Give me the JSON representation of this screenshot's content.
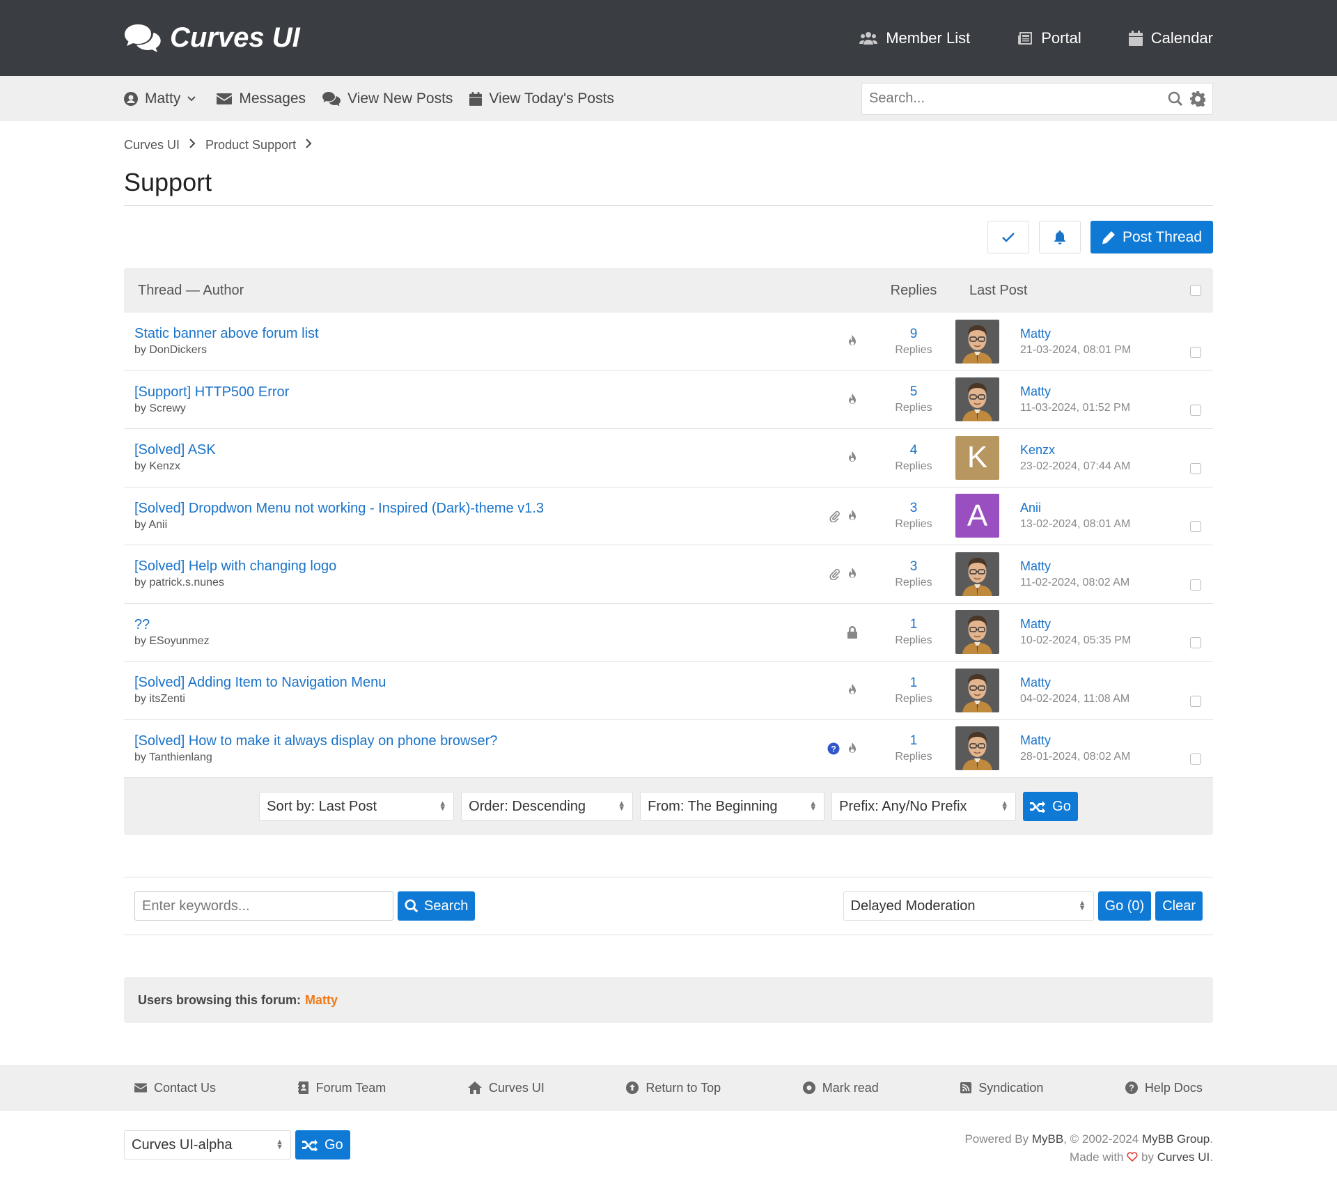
{
  "brand": {
    "name": "Curves UI"
  },
  "topnav": [
    {
      "label": "Member List",
      "icon": "users-icon"
    },
    {
      "label": "Portal",
      "icon": "newspaper-icon"
    },
    {
      "label": "Calendar",
      "icon": "calendar-icon"
    }
  ],
  "subnav": {
    "user": "Matty",
    "messages": "Messages",
    "new_posts": "View New Posts",
    "today_posts": "View Today's Posts",
    "search_placeholder": "Search..."
  },
  "breadcrumb": [
    "Curves UI",
    "Product Support"
  ],
  "page_title": "Support",
  "post_thread": "Post Thread",
  "table": {
    "col_thread": "Thread — Author",
    "col_replies": "Replies",
    "col_last": "Last Post",
    "replies_label": "Replies",
    "threads": [
      {
        "title": "Static banner above forum list",
        "author": "by DonDickers",
        "replies": "9",
        "last_user": "Matty",
        "last_date": "21-03-2024, 08:01 PM",
        "avatar": "photo",
        "icons": [
          "fire"
        ]
      },
      {
        "title": "[Support] HTTP500 Error",
        "author": "by Screwy",
        "replies": "5",
        "last_user": "Matty",
        "last_date": "11-03-2024, 01:52 PM",
        "avatar": "photo",
        "icons": [
          "fire"
        ]
      },
      {
        "title": "[Solved] ASK",
        "author": "by Kenzx",
        "replies": "4",
        "last_user": "Kenzx",
        "last_date": "23-02-2024, 07:44 AM",
        "avatar": "K",
        "icons": [
          "fire"
        ]
      },
      {
        "title": "[Solved] Dropdwon Menu not working - Inspired (Dark)-theme v1.3",
        "author": "by Anii",
        "replies": "3",
        "last_user": "Anii",
        "last_date": "13-02-2024, 08:01 AM",
        "avatar": "A",
        "icons": [
          "paperclip",
          "fire"
        ]
      },
      {
        "title": "[Solved] Help with changing logo",
        "author": "by patrick.s.nunes",
        "replies": "3",
        "last_user": "Matty",
        "last_date": "11-02-2024, 08:02 AM",
        "avatar": "photo",
        "icons": [
          "paperclip",
          "fire"
        ]
      },
      {
        "title": "??",
        "author": "by ESoyunmez",
        "replies": "1",
        "last_user": "Matty",
        "last_date": "10-02-2024, 05:35 PM",
        "avatar": "photo",
        "icons": [
          "lock"
        ]
      },
      {
        "title": "[Solved] Adding Item to Navigation Menu",
        "author": "by itsZenti",
        "replies": "1",
        "last_user": "Matty",
        "last_date": "04-02-2024, 11:08 AM",
        "avatar": "photo",
        "icons": [
          "fire"
        ]
      },
      {
        "title": "[Solved] How to make it always display on phone browser?",
        "author": "by Tanthienlang",
        "replies": "1",
        "last_user": "Matty",
        "last_date": "28-01-2024, 08:02 AM",
        "avatar": "photo",
        "icons": [
          "question",
          "fire"
        ]
      }
    ]
  },
  "sortbar": {
    "sort": "Sort by: Last Post",
    "order": "Order: Descending",
    "from": "From: The Beginning",
    "prefix": "Prefix: Any/No Prefix",
    "go": "Go"
  },
  "lowerbar": {
    "keywords_placeholder": "Enter keywords...",
    "search": "Search",
    "moderation": "Delayed Moderation",
    "go": "Go (0)",
    "clear": "Clear"
  },
  "browsing": {
    "label": "Users browsing this forum:",
    "user": "Matty"
  },
  "footnav": [
    {
      "label": "Contact Us",
      "icon": "envelope-icon"
    },
    {
      "label": "Forum Team",
      "icon": "address-book-icon"
    },
    {
      "label": "Curves UI",
      "icon": "home-icon"
    },
    {
      "label": "Return to Top",
      "icon": "arrow-up-circle-icon"
    },
    {
      "label": "Mark read",
      "icon": "dot-circle-icon"
    },
    {
      "label": "Syndication",
      "icon": "rss-icon"
    },
    {
      "label": "Help Docs",
      "icon": "question-circle-icon"
    }
  ],
  "footer": {
    "theme": "Curves UI-alpha",
    "go": "Go",
    "powered_prefix": "Powered By",
    "mybb": "MyBB",
    "copyright": ", © 2002-2024",
    "group": "MyBB Group",
    "made_prefix": "Made with",
    "made_by": "by",
    "made_name": "Curves UI",
    "period": "."
  },
  "colors": {
    "accent": "#0f7ad6",
    "header": "#3a3d41",
    "highlight": "#ef7a1a",
    "avatar_k": "#b89660",
    "avatar_a": "#9a4fc1"
  }
}
